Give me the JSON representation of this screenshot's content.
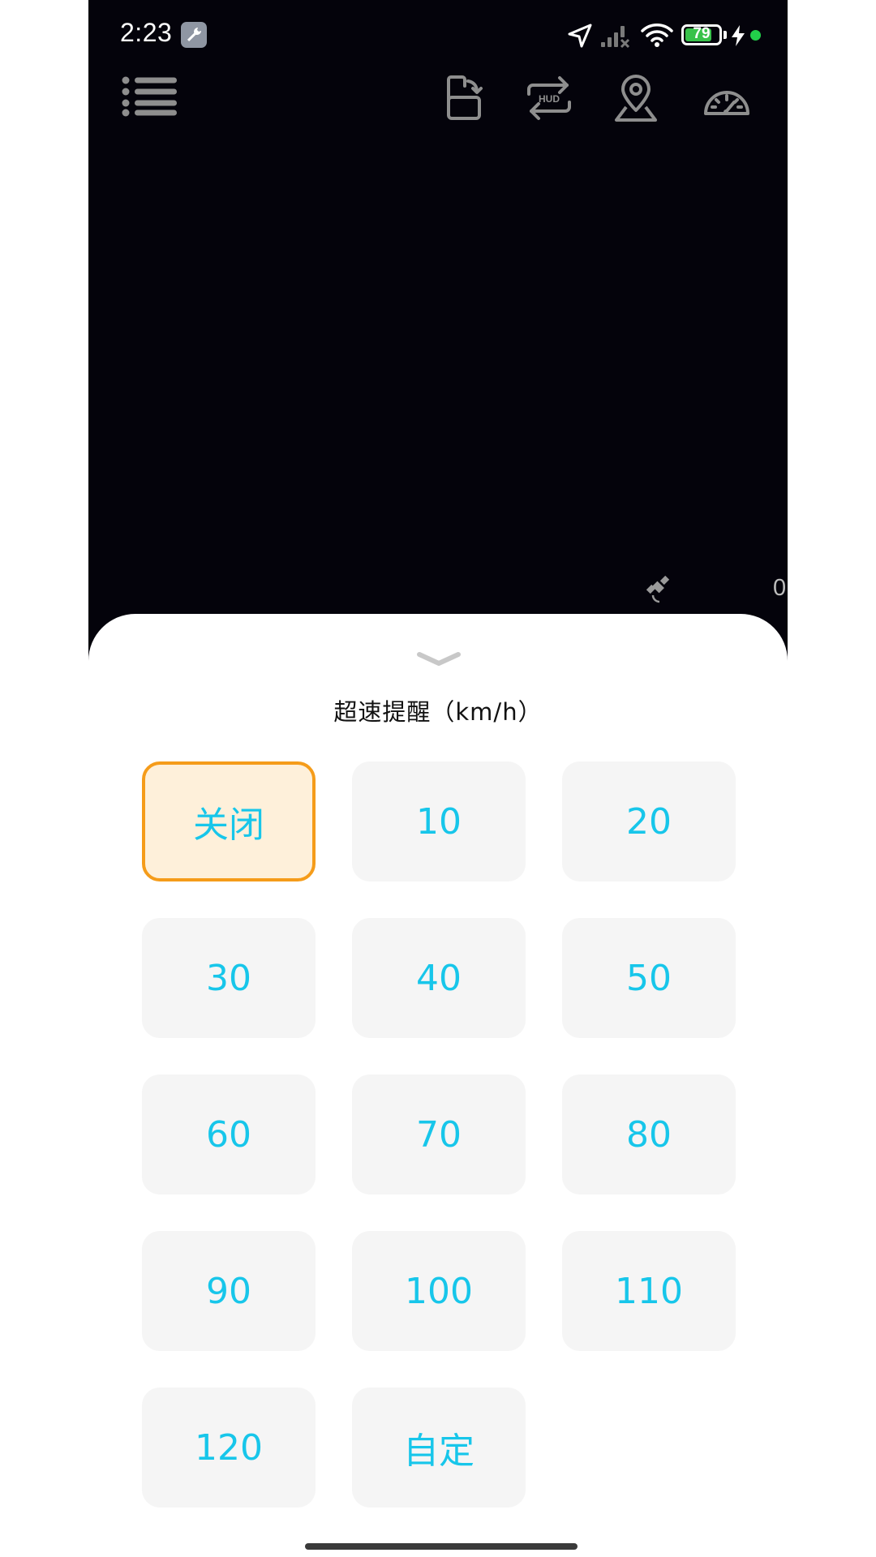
{
  "status_bar": {
    "time": "2:23",
    "battery_level": "79",
    "battery_fraction": 0.79,
    "icons": [
      "wrench-icon",
      "location-arrow-icon",
      "signal-off-icon",
      "wifi-icon",
      "battery-icon",
      "charging-bolt-icon",
      "privacy-dot-icon"
    ],
    "accent_green": "#39c24a"
  },
  "toolbar": {
    "icons": [
      "menu-list-icon",
      "rotate-screen-icon",
      "hud-mirror-icon",
      "map-pin-icon",
      "speedometer-icon"
    ],
    "hud_label": "HUD",
    "icon_color": "#8e8e8e"
  },
  "gps": {
    "satellite_count": "0",
    "icon": "satellite-icon"
  },
  "sheet": {
    "title": "超速提醒（km/h）",
    "options": [
      {
        "label": "关闭",
        "selected": true
      },
      {
        "label": "10",
        "selected": false
      },
      {
        "label": "20",
        "selected": false
      },
      {
        "label": "30",
        "selected": false
      },
      {
        "label": "40",
        "selected": false
      },
      {
        "label": "50",
        "selected": false
      },
      {
        "label": "60",
        "selected": false
      },
      {
        "label": "70",
        "selected": false
      },
      {
        "label": "80",
        "selected": false
      },
      {
        "label": "90",
        "selected": false
      },
      {
        "label": "100",
        "selected": false
      },
      {
        "label": "110",
        "selected": false
      },
      {
        "label": "120",
        "selected": false
      },
      {
        "label": "自定",
        "selected": false
      }
    ],
    "colors": {
      "option_text": "#17c6ea",
      "option_bg": "#f5f5f5",
      "selected_bg": "#fef0da",
      "selected_border": "#f59c1a"
    }
  }
}
